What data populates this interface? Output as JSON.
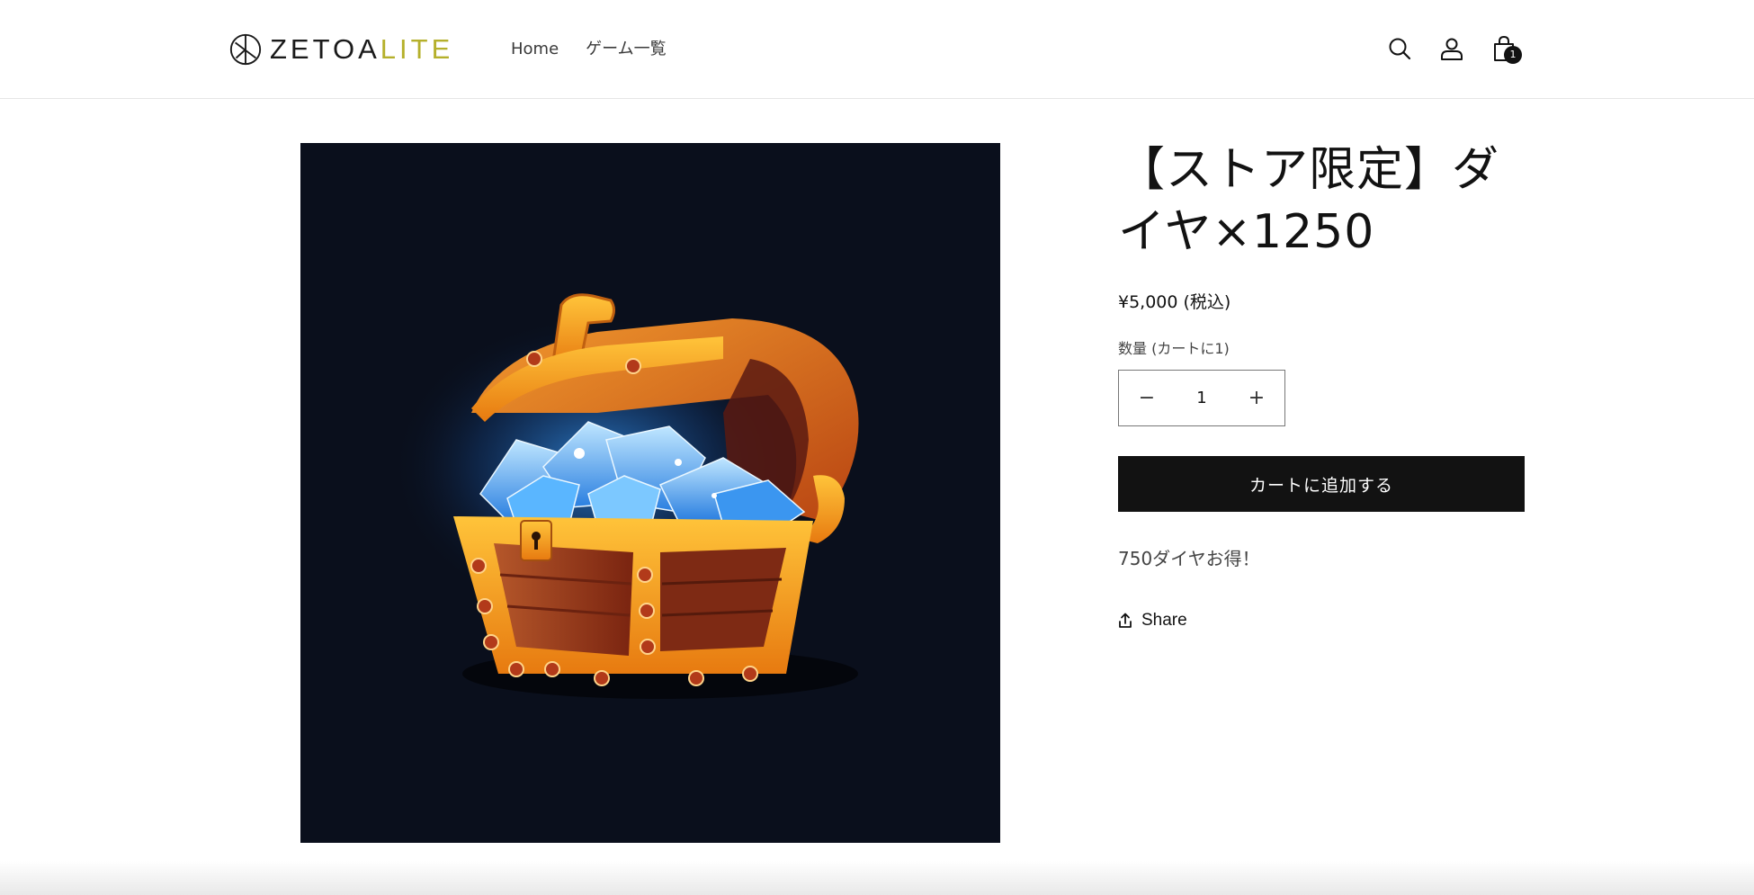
{
  "header": {
    "logo_text_dark": "ZETOA",
    "logo_text_accent": "LITE",
    "nav": [
      {
        "label": "Home"
      },
      {
        "label": "ゲーム一覧"
      }
    ],
    "icons": [
      "search-icon",
      "account-icon",
      "cart-icon"
    ],
    "cart_count": "1"
  },
  "product": {
    "title": "【ストア限定】ダイヤ×1250",
    "price": "¥5,000 (税込)",
    "quantity_label": "数量 (カートに1)",
    "quantity_value": "1",
    "decrement_symbol": "−",
    "increment_symbol": "+",
    "add_to_cart": "カートに追加する",
    "description": "750ダイヤお得！",
    "share_label": "Share"
  },
  "colors": {
    "accent": "#b5b02b",
    "button": "#121212",
    "media_bg": "#0a0f1c"
  }
}
